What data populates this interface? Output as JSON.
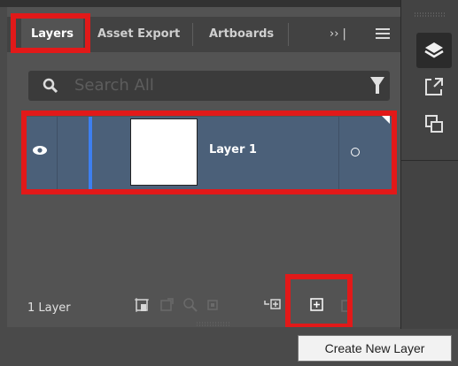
{
  "tabs": [
    {
      "label": "Layers",
      "active": true
    },
    {
      "label": "Asset Export",
      "active": false
    },
    {
      "label": "Artboards",
      "active": false
    }
  ],
  "tabs_more": "›› |",
  "search": {
    "placeholder": "Search All"
  },
  "layers": [
    {
      "name": "Layer 1",
      "visible": true,
      "color": "#3d7ff0"
    }
  ],
  "footer": {
    "count_label": "1 Layer"
  },
  "tooltip": "Create New Layer",
  "right_toolbar": {
    "items": [
      "layers-icon",
      "export-icon",
      "artboards-icon"
    ]
  },
  "colors": {
    "panel": "#535353",
    "selected_row": "#4b6079",
    "highlight": "#e21919"
  },
  "icons": [
    "search-icon",
    "filter-icon",
    "eye-icon",
    "panel-menu-icon",
    "collect-for-export-icon",
    "locate-object-icon",
    "make-clipping-mask-icon",
    "create-new-sublayer-icon",
    "create-new-layer-icon",
    "delete-icon"
  ]
}
